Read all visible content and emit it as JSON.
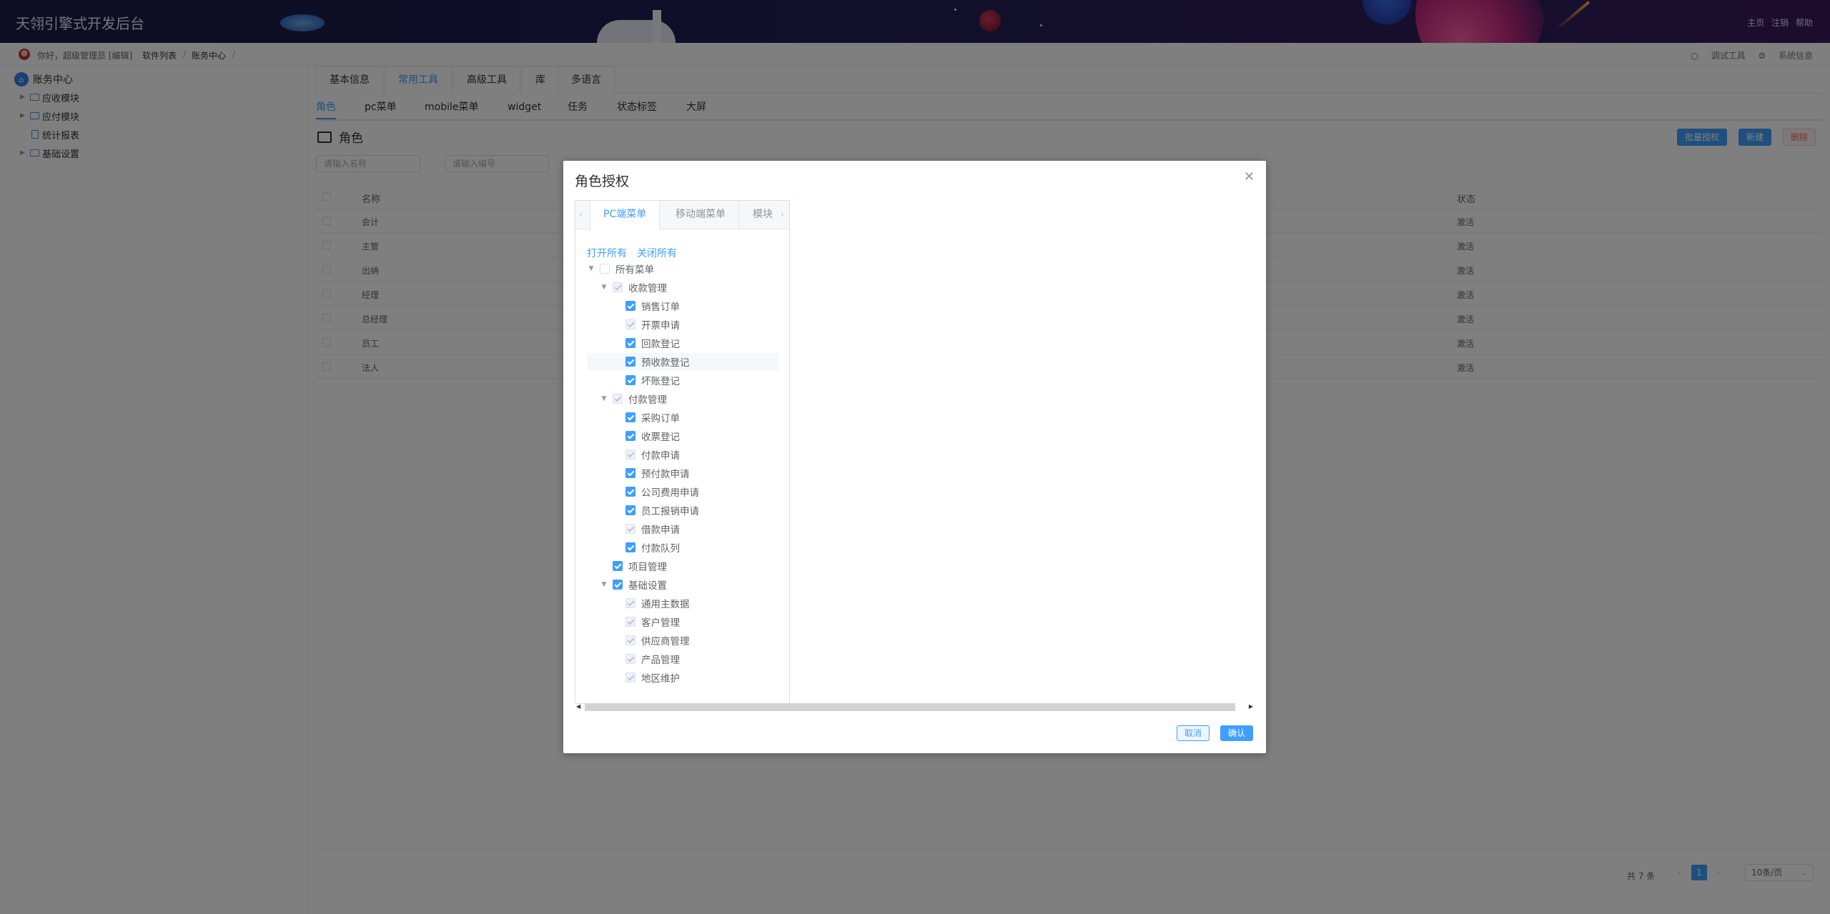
{
  "header": {
    "title": "天翎引擎式开发后台",
    "links": [
      "主页",
      "注销",
      "帮助"
    ]
  },
  "breadcrumb": {
    "greeting": "你好，超级管理员 [编辑]",
    "items": [
      "软件列表",
      "账务中心"
    ],
    "separator": "/",
    "tools": [
      "调试工具",
      "系统信息"
    ]
  },
  "sidebar": {
    "root": "账务中心",
    "items": [
      {
        "label": "应收模块",
        "type": "folder"
      },
      {
        "label": "应付模块",
        "type": "folder"
      },
      {
        "label": "统计报表",
        "type": "doc"
      },
      {
        "label": "基础设置",
        "type": "folder"
      }
    ]
  },
  "main": {
    "tabs": [
      "基本信息",
      "常用工具",
      "高级工具",
      "库",
      "多语言"
    ],
    "active_tab": "常用工具",
    "subtabs": [
      "角色",
      "pc菜单",
      "mobile菜单",
      "widget",
      "任务",
      "状态标签",
      "大屏"
    ],
    "active_subtab": "角色",
    "section_title": "角色",
    "buttons": {
      "batch_auth": "批量授权",
      "create": "新建",
      "delete": "删除"
    },
    "search": {
      "name_placeholder": "请输入名称",
      "code_placeholder": "请输入编号"
    },
    "table": {
      "columns": {
        "name": "名称",
        "status": "状态"
      },
      "rows": [
        {
          "name": "会计",
          "status": "激活"
        },
        {
          "name": "主管",
          "status": "激活"
        },
        {
          "name": "出纳",
          "status": "激活"
        },
        {
          "name": "经理",
          "status": "激活"
        },
        {
          "name": "总经理",
          "status": "激活"
        },
        {
          "name": "员工",
          "status": "激活"
        },
        {
          "name": "法人",
          "status": "激活"
        }
      ]
    },
    "pager": {
      "total": "共 7 条",
      "current": "1",
      "page_size": "10条/页"
    }
  },
  "dialog": {
    "title": "角色授权",
    "tabs": [
      "PC端菜单",
      "移动端菜单",
      "模块"
    ],
    "active_tab": "PC端菜单",
    "open_all": "打开所有",
    "close_all": "关闭所有",
    "tree": [
      {
        "label": "所有菜单",
        "level": 0,
        "state": "off",
        "caret": true
      },
      {
        "label": "收款管理",
        "level": 1,
        "state": "dis",
        "caret": true
      },
      {
        "label": "销售订单",
        "level": 2,
        "state": "on"
      },
      {
        "label": "开票申请",
        "level": 2,
        "state": "dis"
      },
      {
        "label": "回款登记",
        "level": 2,
        "state": "on"
      },
      {
        "label": "预收款登记",
        "level": 2,
        "state": "on",
        "highlight": true
      },
      {
        "label": "坏账登记",
        "level": 2,
        "state": "on"
      },
      {
        "label": "付款管理",
        "level": 1,
        "state": "dis",
        "caret": true
      },
      {
        "label": "采购订单",
        "level": 2,
        "state": "on"
      },
      {
        "label": "收票登记",
        "level": 2,
        "state": "on"
      },
      {
        "label": "付款申请",
        "level": 2,
        "state": "dis"
      },
      {
        "label": "预付款申请",
        "level": 2,
        "state": "on"
      },
      {
        "label": "公司费用申请",
        "level": 2,
        "state": "on"
      },
      {
        "label": "员工报销申请",
        "level": 2,
        "state": "on"
      },
      {
        "label": "借款申请",
        "level": 2,
        "state": "dis"
      },
      {
        "label": "付款队列",
        "level": 2,
        "state": "on"
      },
      {
        "label": "项目管理",
        "level": 1,
        "state": "on"
      },
      {
        "label": "基础设置",
        "level": 1,
        "state": "on",
        "caret": true
      },
      {
        "label": "通用主数据",
        "level": 2,
        "state": "dis"
      },
      {
        "label": "客户管理",
        "level": 2,
        "state": "dis"
      },
      {
        "label": "供应商管理",
        "level": 2,
        "state": "dis"
      },
      {
        "label": "产品管理",
        "level": 2,
        "state": "dis"
      },
      {
        "label": "地区维护",
        "level": 2,
        "state": "dis"
      }
    ],
    "cancel": "取消",
    "confirm": "确认"
  },
  "colors": {
    "accent": "#409eff",
    "header_bg": "#1b1a4a",
    "danger": "#f56c6c"
  }
}
